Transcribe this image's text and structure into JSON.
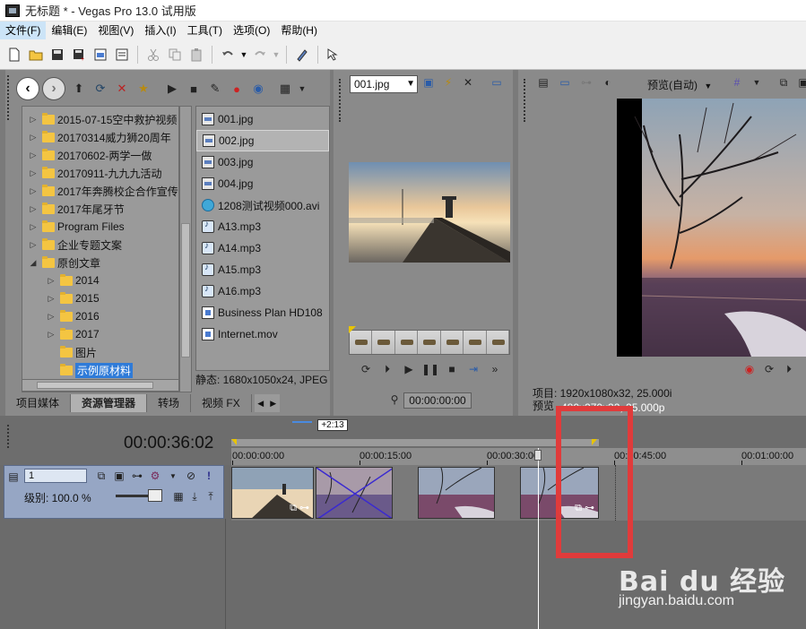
{
  "window": {
    "title": "无标题 * - Vegas Pro 13.0 试用版"
  },
  "menu": [
    "文件(F)",
    "编辑(E)",
    "视图(V)",
    "插入(I)",
    "工具(T)",
    "选项(O)",
    "帮助(H)"
  ],
  "explorer": {
    "tree": [
      {
        "label": "2015-07-15空中救护视频",
        "expandable": true,
        "indent": 0
      },
      {
        "label": "20170314威力狮20周年",
        "expandable": true,
        "indent": 0
      },
      {
        "label": "20170602-两学一做",
        "expandable": true,
        "indent": 0
      },
      {
        "label": "20170911-九九九活动",
        "expandable": true,
        "indent": 0
      },
      {
        "label": "2017年奔腾校企合作宣传",
        "expandable": true,
        "indent": 0
      },
      {
        "label": "2017年尾牙节",
        "expandable": true,
        "indent": 0
      },
      {
        "label": "Program Files",
        "expandable": true,
        "indent": 0
      },
      {
        "label": "企业专题文案",
        "expandable": true,
        "indent": 0
      },
      {
        "label": "原创文章",
        "expandable": true,
        "expanded": true,
        "indent": 0
      },
      {
        "label": "2014",
        "expandable": true,
        "indent": 1
      },
      {
        "label": "2015",
        "expandable": true,
        "indent": 1
      },
      {
        "label": "2016",
        "expandable": true,
        "indent": 1
      },
      {
        "label": "2017",
        "expandable": true,
        "indent": 1
      },
      {
        "label": "图片",
        "expandable": false,
        "indent": 1
      },
      {
        "label": "示例原材料",
        "expandable": false,
        "indent": 1,
        "selected": true
      }
    ],
    "files": [
      {
        "name": "001.jpg",
        "type": "img"
      },
      {
        "name": "002.jpg",
        "type": "img",
        "selected": true
      },
      {
        "name": "003.jpg",
        "type": "img"
      },
      {
        "name": "004.jpg",
        "type": "img"
      },
      {
        "name": "1208测试视频000.avi",
        "type": "video"
      },
      {
        "name": "A13.mp3",
        "type": "audio"
      },
      {
        "name": "A14.mp3",
        "type": "audio"
      },
      {
        "name": "A15.mp3",
        "type": "audio"
      },
      {
        "name": "A16.mp3",
        "type": "audio"
      },
      {
        "name": "Business Plan HD108",
        "type": "doc"
      },
      {
        "name": "Internet.mov",
        "type": "doc"
      }
    ],
    "status": "静态: 1680x1050x24, JPEG",
    "tabs": [
      "项目媒体",
      "资源管理器",
      "转场",
      "视频 FX"
    ],
    "active_tab": 1
  },
  "trimmer": {
    "selected_file": "001.jpg",
    "time": "00:00:00:00"
  },
  "preview": {
    "mode": "预览(自动)",
    "project_info": "项目: 1920x1080x32, 25.000i",
    "preview_info_label": "预览",
    "preview_info_value": "480x270x32, 25.000p"
  },
  "timeline": {
    "timecode": "00:00:36:02",
    "offset": "+2:13",
    "ruler": [
      "00:00:00:00",
      "00:00:15:00",
      "00:00:30:00",
      "00:00:45:00",
      "00:01:00:00"
    ],
    "track": {
      "number": "1",
      "level_label": "级别: 100.0 %"
    }
  },
  "watermark": {
    "brand": "Bai du 经验",
    "url": "jingyan.baidu.com"
  },
  "colors": {
    "highlight_box": "#e03b3b",
    "selection": "#2f7bd8",
    "track_header": "#96a6c4"
  }
}
